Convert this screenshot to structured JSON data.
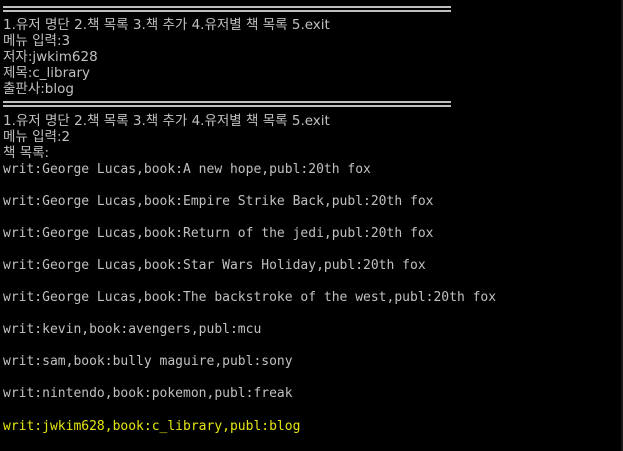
{
  "console": {
    "menu_line": "1.유저 명단 2.책 목록 3.책 추가 4.유저별 책 목록 5.exit",
    "session1": {
      "menu_input": "메뉴 입력:3",
      "author_input": "저자:jwkim628",
      "title_input": "제목:c_library",
      "publisher_input": "출판사:blog"
    },
    "session2": {
      "menu_input": "메뉴 입력:2",
      "list_header": "책 목록:"
    },
    "books": [
      "writ:George Lucas,book:A new hope,publ:20th fox",
      "writ:George Lucas,book:Empire Strike Back,publ:20th fox",
      "writ:George Lucas,book:Return of the jedi,publ:20th fox",
      "writ:George Lucas,book:Star Wars Holiday,publ:20th fox",
      "writ:George Lucas,book:The backstroke of the west,publ:20th fox",
      "writ:kevin,book:avengers,publ:mcu",
      "writ:sam,book:bully maguire,publ:sony",
      "writ:nintendo,book:pokemon,publ:freak",
      "writ:jwkim628,book:c_library,publ:blog"
    ],
    "colors": {
      "background": "#000000",
      "text": "#c0c0c0",
      "highlight": "#e5e510"
    }
  }
}
